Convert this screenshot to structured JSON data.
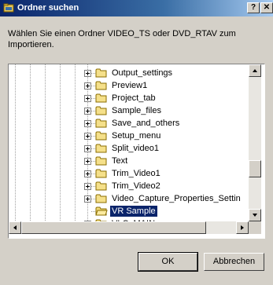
{
  "window": {
    "title": "Ordner suchen",
    "help_label": "?",
    "close_label": "✕"
  },
  "instruction": "Wählen Sie einen Ordner VIDEO_TS oder DVD_RTAV zum\nImportieren.",
  "tree": {
    "items": [
      {
        "label": "Output_settings",
        "expandable": true,
        "selected": false
      },
      {
        "label": "Preview1",
        "expandable": true,
        "selected": false
      },
      {
        "label": "Project_tab",
        "expandable": true,
        "selected": false
      },
      {
        "label": "Sample_files",
        "expandable": true,
        "selected": false
      },
      {
        "label": "Save_and_others",
        "expandable": true,
        "selected": false
      },
      {
        "label": "Setup_menu",
        "expandable": true,
        "selected": false
      },
      {
        "label": "Split_video1",
        "expandable": true,
        "selected": false
      },
      {
        "label": "Text",
        "expandable": true,
        "selected": false
      },
      {
        "label": "Trim_Video1",
        "expandable": true,
        "selected": false
      },
      {
        "label": "Trim_Video2",
        "expandable": true,
        "selected": false
      },
      {
        "label": "Video_Capture_Properties_Settin",
        "expandable": true,
        "selected": false
      },
      {
        "label": "VR Sample",
        "expandable": false,
        "selected": true
      },
      {
        "label": "VLC_MAIN",
        "expandable": true,
        "selected": false
      }
    ]
  },
  "buttons": {
    "ok_label": "OK",
    "cancel_label": "Abbrechen"
  }
}
